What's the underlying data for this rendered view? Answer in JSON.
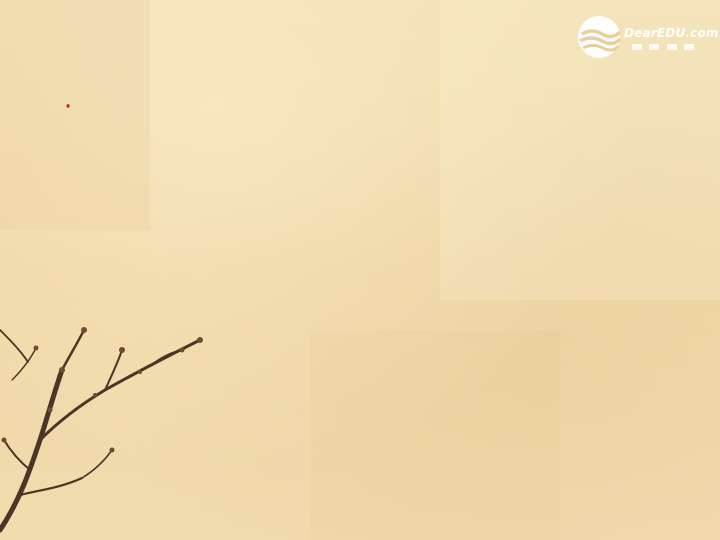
{
  "logo": {
    "text": "DearEDU.com",
    "icon": "dearedu-logo-icon"
  },
  "title": {
    "part1": "",
    "separator": "·",
    "part2": ""
  },
  "body": {
    "paragraph": ""
  },
  "decoration": {
    "icon": "plum-branch-icon",
    "text_color": "#4b1eee",
    "title_color": "#c0141e"
  }
}
